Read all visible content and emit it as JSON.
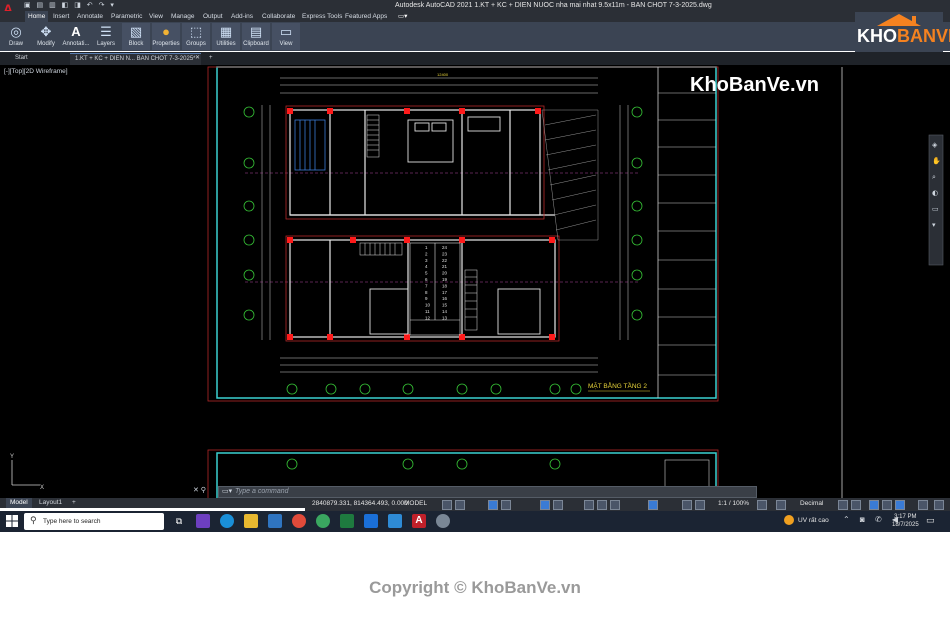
{
  "window": {
    "app_title": "Autodesk AutoCAD 2021    1.KT + KC + DIEN NUOC nha mai nhat 9.5x11m - BAN CHOT 7-3-2025.dwg",
    "app_logo": "A"
  },
  "ribbon_tabs": [
    "Home",
    "Insert",
    "Annotate",
    "Parametric",
    "View",
    "Manage",
    "Output",
    "Add-ins",
    "Collaborate",
    "Express Tools",
    "Featured Apps"
  ],
  "ribbon_panels": [
    {
      "label": "Draw",
      "icon": "draw-icon"
    },
    {
      "label": "Modify",
      "icon": "modify-icon"
    },
    {
      "label": "Annotati...",
      "icon": "annotation-icon"
    },
    {
      "label": "Layers",
      "icon": "layers-icon"
    },
    {
      "label": "Block",
      "icon": "block-icon"
    },
    {
      "label": "Properties",
      "icon": "properties-icon"
    },
    {
      "label": "Groups",
      "icon": "groups-icon"
    },
    {
      "label": "Utilities",
      "icon": "utilities-icon"
    },
    {
      "label": "Clipboard",
      "icon": "clipboard-icon"
    },
    {
      "label": "View",
      "icon": "view-icon"
    }
  ],
  "file_tabs": {
    "start": "Start",
    "active": "1.KT + KC + DIEN N... BAN CHOT 7-3-2025*"
  },
  "viewport_label": "[-][Top][2D Wireframe]",
  "drawing": {
    "title": "MẶT BẰNG TẦNG 2",
    "top_dimension": "12400",
    "stair_steps_left": [
      "1",
      "2",
      "3",
      "4",
      "5",
      "6",
      "7",
      "8",
      "9",
      "10",
      "11",
      "12"
    ],
    "stair_steps_right": [
      "24",
      "23",
      "22",
      "21",
      "20",
      "19",
      "18",
      "17",
      "16",
      "15",
      "14",
      "13"
    ]
  },
  "watermark": "KhoBanVe.vn",
  "brand": {
    "part1": "KHO",
    "part2": "BANVE"
  },
  "command_line": {
    "placeholder": "Type a command"
  },
  "layout_tabs": [
    "Model",
    "Layout1"
  ],
  "status": {
    "coords": "2840879.331, 814364.493, 0.000",
    "mode": "MODEL",
    "scale": "1:1 / 100%",
    "units": "Decimal"
  },
  "taskbar": {
    "search_placeholder": "Type here to search",
    "weather": "UV rất cao",
    "time": "3:17 PM",
    "date": "18/7/2025"
  },
  "copyright": "Copyright © KhoBanVe.vn"
}
